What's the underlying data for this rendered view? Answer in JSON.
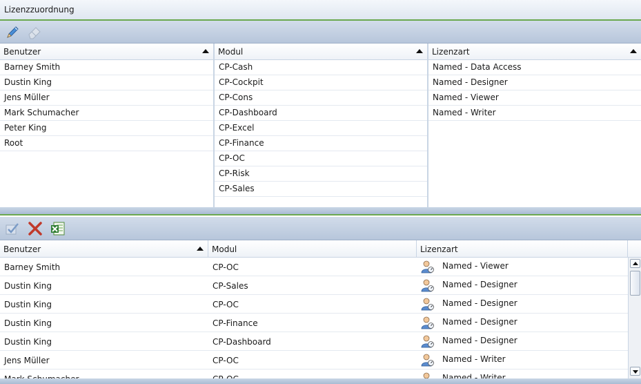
{
  "title": "Lizenzzuordnung",
  "top_toolbar": {
    "edit_icon": "pencil-icon",
    "clear_icon": "eraser-icon"
  },
  "panes": [
    {
      "header": "Benutzer",
      "items": [
        "Barney Smith",
        "Dustin King",
        "Jens Müller",
        "Mark Schumacher",
        "Peter King",
        "Root"
      ]
    },
    {
      "header": "Modul",
      "items": [
        "CP-Cash",
        "CP-Cockpit",
        "CP-Cons",
        "CP-Dashboard",
        "CP-Excel",
        "CP-Finance",
        "CP-OC",
        "CP-Risk",
        "CP-Sales"
      ]
    },
    {
      "header": "Lizenzart",
      "items": [
        "Named - Data Access",
        "Named - Designer",
        "Named - Viewer",
        "Named - Writer"
      ]
    }
  ],
  "bottom_toolbar": {
    "confirm_icon": "check-icon",
    "delete_icon": "delete-x-icon",
    "export_icon": "excel-icon"
  },
  "grid": {
    "columns": [
      "Benutzer",
      "Modul",
      "Lizenzart"
    ],
    "rows": [
      {
        "benutzer": "Barney Smith",
        "modul": "CP-OC",
        "lizenzart": "Named - Viewer"
      },
      {
        "benutzer": "Dustin King",
        "modul": "CP-Sales",
        "lizenzart": "Named - Designer"
      },
      {
        "benutzer": "Dustin King",
        "modul": "CP-OC",
        "lizenzart": "Named - Designer"
      },
      {
        "benutzer": "Dustin King",
        "modul": "CP-Finance",
        "lizenzart": "Named - Designer"
      },
      {
        "benutzer": "Dustin King",
        "modul": "CP-Dashboard",
        "lizenzart": "Named - Designer"
      },
      {
        "benutzer": "Jens Müller",
        "modul": "CP-OC",
        "lizenzart": "Named - Writer"
      },
      {
        "benutzer": "Mark Schumacher",
        "modul": "CP-OC",
        "lizenzart": "Named - Writer"
      }
    ]
  },
  "colors": {
    "accent": "#6aa84f",
    "toolbar": "#c3d0e2"
  }
}
